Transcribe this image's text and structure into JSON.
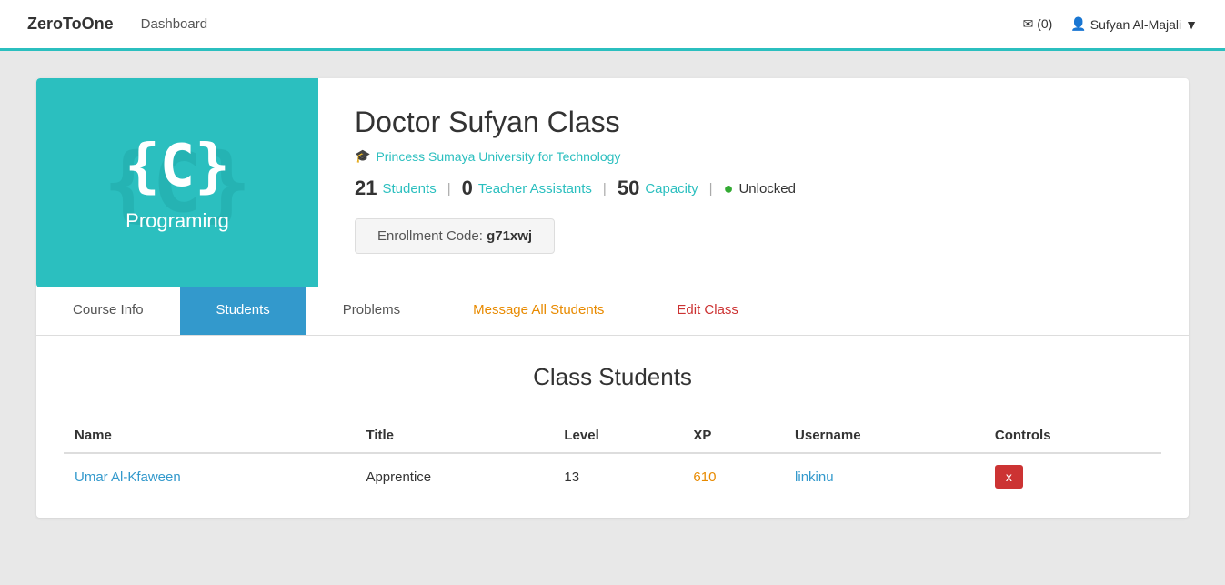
{
  "navbar": {
    "brand": "ZeroToOne",
    "nav_link": "Dashboard",
    "notif_label": "(0)",
    "notif_icon": "✉",
    "user_name": "Sufyan Al-Majali",
    "user_icon": "▼"
  },
  "course": {
    "image_icon": "{C}",
    "image_subtitle": "Programing",
    "name": "Doctor Sufyan Class",
    "university": "Princess Sumaya University for Technology",
    "university_icon": "🎓",
    "students_count": "21",
    "students_label": "Students",
    "ta_count": "0",
    "ta_label": "Teacher Assistants",
    "capacity_count": "50",
    "capacity_label": "Capacity",
    "status": "Unlocked",
    "enrollment_prefix": "Enrollment Code:",
    "enrollment_code": "g71xwj"
  },
  "tabs": [
    {
      "label": "Course Info",
      "active": false,
      "style": "normal"
    },
    {
      "label": "Students",
      "active": true,
      "style": "normal"
    },
    {
      "label": "Problems",
      "active": false,
      "style": "normal"
    },
    {
      "label": "Message All Students",
      "active": false,
      "style": "orange"
    },
    {
      "label": "Edit Class",
      "active": false,
      "style": "red"
    }
  ],
  "students_section": {
    "title": "Class Students",
    "columns": [
      "Name",
      "Title",
      "Level",
      "XP",
      "Username",
      "Controls"
    ],
    "rows": [
      {
        "name": "Umar Al-Kfaween",
        "title": "Apprentice",
        "level": "13",
        "xp": "610",
        "username": "linkinu",
        "control": "x"
      }
    ]
  }
}
